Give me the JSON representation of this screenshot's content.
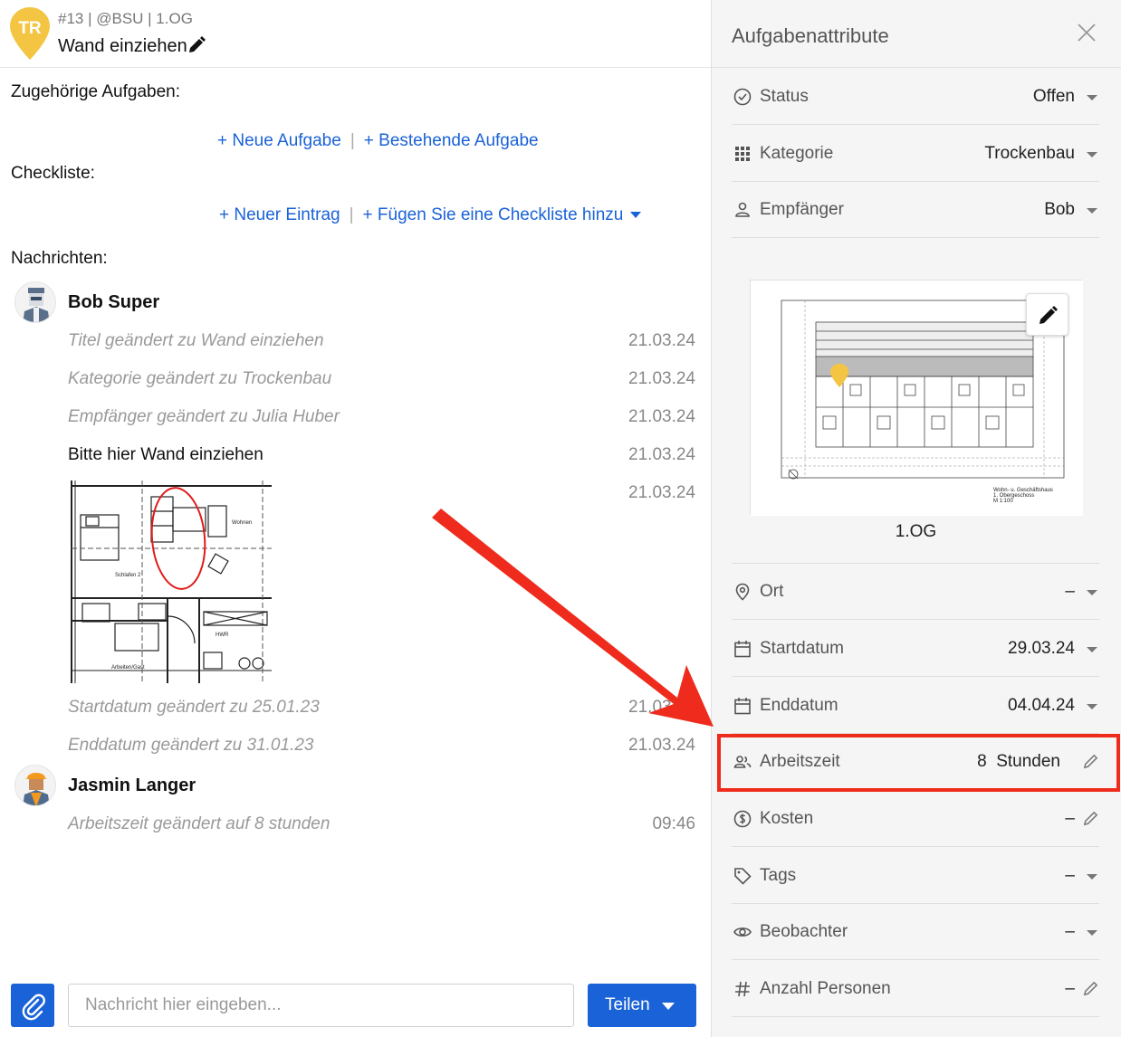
{
  "header": {
    "pin_initials": "TR",
    "breadcrumb": "#13 | @BSU | 1.OG",
    "title": "Wand einziehen"
  },
  "related": {
    "label": "Zugehörige Aufgaben:",
    "new_task": "+ Neue Aufgabe",
    "separator": "|",
    "existing_task": "+ Bestehende Aufgabe"
  },
  "checklist": {
    "label": "Checkliste:",
    "new_entry": "+ Neuer Eintrag",
    "separator": "|",
    "add_checklist": "+ Fügen Sie eine Checkliste hinzu"
  },
  "messages": {
    "label": "Nachrichten:",
    "groups": [
      {
        "author": "Bob Super",
        "lines": [
          {
            "text": "Titel geändert zu Wand einziehen",
            "time": "21.03.24"
          },
          {
            "text": "Kategorie geändert zu Trockenbau",
            "time": "21.03.24"
          },
          {
            "text": "Empfänger geändert zu Julia Huber",
            "time": "21.03.24"
          },
          {
            "text": "Bitte hier Wand einziehen",
            "time": "21.03.24"
          },
          {
            "text": "",
            "time": "21.03.24"
          },
          {
            "text": "Startdatum geändert zu 25.01.23",
            "time": "21.03.24"
          },
          {
            "text": "Enddatum geändert zu 31.01.23",
            "time": "21.03.24"
          }
        ]
      },
      {
        "author": "Jasmin Langer",
        "lines": [
          {
            "text": "Arbeitszeit geändert auf 8 stunden",
            "time": "09:46"
          }
        ]
      }
    ],
    "attachment_labels": {
      "room1": "Wohnen",
      "room2": "Schlafen 2",
      "room3": "HWR",
      "room4": "Arbeiten/Gast"
    }
  },
  "composer": {
    "placeholder": "Nachricht hier eingeben...",
    "share_label": "Teilen"
  },
  "attributes": {
    "title": "Aufgabenattribute",
    "rows": [
      {
        "label": "Status",
        "value": "Offen",
        "icon": "check-circle-icon"
      },
      {
        "label": "Kategorie",
        "value": "Trockenbau",
        "icon": "grid-icon"
      },
      {
        "label": "Empfänger",
        "value": "Bob",
        "icon": "person-icon"
      }
    ],
    "plan": {
      "caption": "1.OG",
      "stamp_line1": "Wohn- u. Geschäftshaus",
      "stamp_line2": "1. Obergeschoss",
      "stamp_line3": "M 1:100"
    },
    "rows2": [
      {
        "label": "Ort",
        "value": "–",
        "icon": "location-icon"
      },
      {
        "label": "Startdatum",
        "value": "29.03.24",
        "icon": "calendar-icon"
      },
      {
        "label": "Enddatum",
        "value": "04.04.24",
        "icon": "calendar-icon"
      },
      {
        "label": "Arbeitszeit",
        "value_num": "8",
        "value_unit": "Stunden",
        "icon": "people-icon"
      },
      {
        "label": "Kosten",
        "value": "–",
        "icon": "dollar-icon"
      },
      {
        "label": "Tags",
        "value": "–",
        "icon": "tag-icon"
      },
      {
        "label": "Beobachter",
        "value": "–",
        "icon": "eye-icon"
      },
      {
        "label": "Anzahl Personen",
        "value": "–",
        "icon": "hash-icon"
      }
    ]
  },
  "colors": {
    "accent": "#1a62d8",
    "pin": "#f4c542",
    "highlight": "#ee2b1c"
  }
}
